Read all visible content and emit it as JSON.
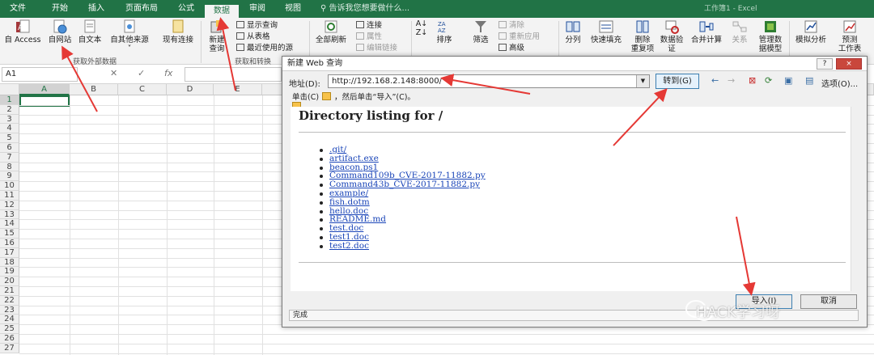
{
  "ribbon_tabs": [
    "文件",
    "开始",
    "插入",
    "页面布局",
    "公式",
    "数据",
    "审阅",
    "视图"
  ],
  "active_tab": "数据",
  "tell_me": "告诉我您想要做什么...",
  "window_title": "工作簿1 - Excel",
  "ribbon": {
    "access": "自 Access",
    "web": "自网站",
    "text": "自文本",
    "other": "自其他来源",
    "existing": "现有连接",
    "new_query_1": "新建",
    "new_query_2": "查询",
    "show_query": "显示查询",
    "from_table": "从表格",
    "recent_sources": "最近使用的源",
    "refresh_all": "全部刷新",
    "connections": "连接",
    "properties": "属性",
    "edit_links": "编辑链接",
    "sort": "排序",
    "filter": "筛选",
    "clear": "清除",
    "reapply": "重新应用",
    "advanced": "高级",
    "split": "分列",
    "flash_fill": "快速填充",
    "remove_dup_1": "删除",
    "remove_dup_2": "重复项",
    "validation_1": "数据验",
    "validation_2": "证",
    "consolidate": "合并计算",
    "relationships": "关系",
    "data_model_1": "管理数",
    "data_model_2": "据模型",
    "what_if": "模拟分析",
    "forecast_1": "预测",
    "forecast_2": "工作表",
    "group_external": "获取外部数据",
    "group_transform": "获取和转换"
  },
  "formula_bar": {
    "name_box": "A1",
    "fx": "fx"
  },
  "columns": [
    "A",
    "B",
    "C",
    "D",
    "E"
  ],
  "rows": [
    "1",
    "2",
    "3",
    "4",
    "5",
    "6",
    "7",
    "8",
    "9",
    "10",
    "11",
    "12",
    "13",
    "14",
    "15",
    "16",
    "17",
    "18",
    "19",
    "20",
    "21",
    "22",
    "23",
    "24",
    "25",
    "26",
    "27"
  ],
  "dialog": {
    "title": "新建 Web 查询",
    "help": "?",
    "close": "×",
    "address_label": "地址(D):",
    "address_value": "http://192.168.2.148:8000/",
    "go_button": "转到(G)",
    "options": "选项(O)...",
    "hint_prefix": "单击(C)",
    "hint_suffix": "，然后单击“导入”(C)。",
    "page_heading": "Directory listing for /",
    "files": [
      ".git/",
      "artifact.exe",
      "beacon.ps1",
      "Command109b_CVE-2017-11882.py",
      "Command43b_CVE-2017-11882.py",
      "example/",
      "fish.dotm",
      "hello.doc",
      "README.md",
      "test.doc",
      "test1.doc",
      "test2.doc"
    ],
    "import_button": "导入(I)",
    "cancel_button": "取消",
    "status": "完成"
  },
  "watermark": "HACK学习呀",
  "colors": {
    "excel_green": "#217346",
    "annotation_red": "#e53935",
    "link_blue": "#1a45b8"
  }
}
